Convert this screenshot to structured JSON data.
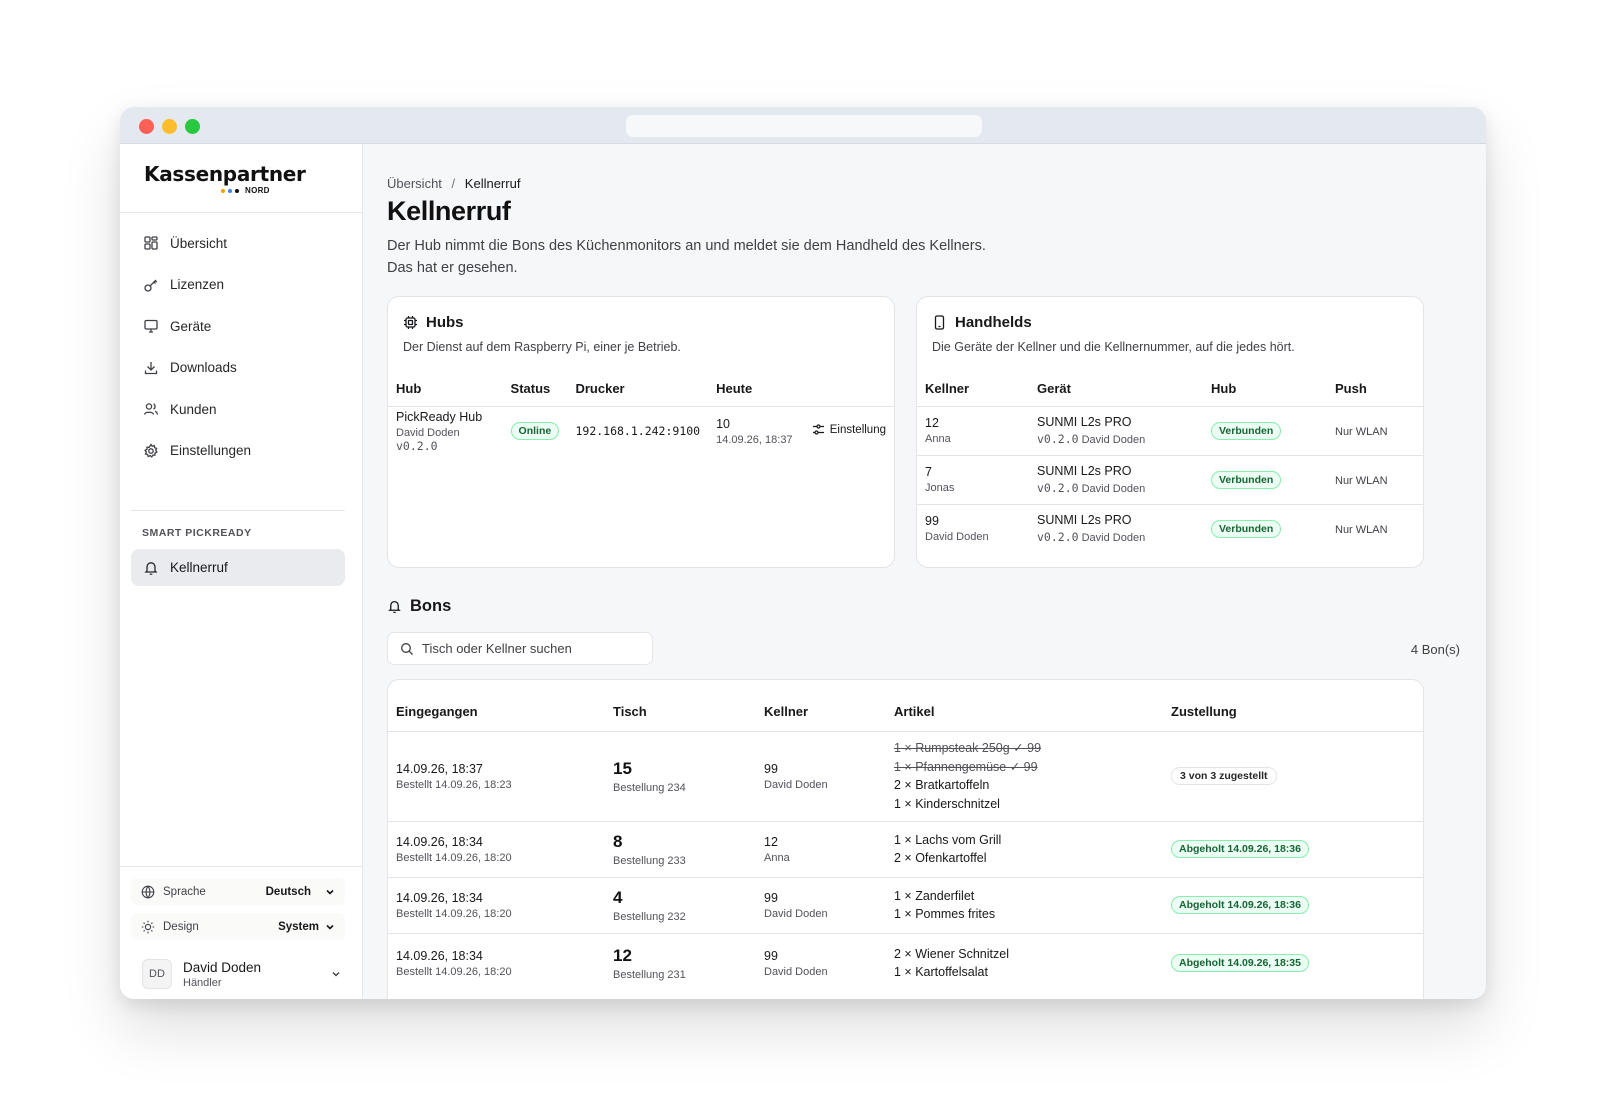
{
  "brand": {
    "name": "Kassenpartner",
    "sub": "NORD",
    "dot_colors": [
      "#f59e0b",
      "#3b82f6",
      "#111111"
    ]
  },
  "sidebar": {
    "items": [
      {
        "label": "Übersicht",
        "icon": "grid-icon"
      },
      {
        "label": "Lizenzen",
        "icon": "key-icon"
      },
      {
        "label": "Geräte",
        "icon": "monitor-icon"
      },
      {
        "label": "Downloads",
        "icon": "download-icon"
      },
      {
        "label": "Kunden",
        "icon": "users-icon"
      },
      {
        "label": "Einstellungen",
        "icon": "gear-icon"
      }
    ],
    "section_label": "SMART PICKREADY",
    "active_item": {
      "label": "Kellnerruf",
      "icon": "bell-icon"
    },
    "language_label": "Sprache",
    "language_value": "Deutsch",
    "design_label": "Design",
    "design_value": "System",
    "user": {
      "initials": "DD",
      "name": "David Doden",
      "role": "Händler"
    }
  },
  "breadcrumb": {
    "root": "Übersicht",
    "sep": "/",
    "current": "Kellnerruf"
  },
  "page": {
    "title": "Kellnerruf",
    "desc_line1": "Der Hub nimmt die Bons des Küchenmonitors an und meldet sie dem Handheld des Kellners.",
    "desc_line2": "Das hat er gesehen."
  },
  "hubs": {
    "title": "Hubs",
    "subtitle": "Der Dienst auf dem Raspberry Pi, einer je Betrieb.",
    "columns": [
      "Hub",
      "Status",
      "Drucker",
      "Heute"
    ],
    "rows": [
      {
        "name": "PickReady Hub",
        "owner": "David Doden",
        "version": "v0.2.0",
        "status": "Online",
        "printer": "192.168.1.242:9100",
        "today": "10",
        "today_time": "14.09.26, 18:37",
        "action": "Einstellung"
      }
    ]
  },
  "handhelds": {
    "title": "Handhelds",
    "subtitle": "Die Geräte der Kellner und die Kellnernummer, auf die jedes hört.",
    "columns": [
      "Kellner",
      "Gerät",
      "Hub",
      "Push"
    ],
    "rows": [
      {
        "number": "12",
        "name": "Anna",
        "device": "SUNMI L2s PRO",
        "version": "v0.2.0",
        "owner": "David Doden",
        "hub": "Verbunden",
        "push": "Nur WLAN"
      },
      {
        "number": "7",
        "name": "Jonas",
        "device": "SUNMI L2s PRO",
        "version": "v0.2.0",
        "owner": "David Doden",
        "hub": "Verbunden",
        "push": "Nur WLAN"
      },
      {
        "number": "99",
        "name": "David Doden",
        "device": "SUNMI L2s PRO",
        "version": "v0.2.0",
        "owner": "David Doden",
        "hub": "Verbunden",
        "push": "Nur WLAN"
      }
    ]
  },
  "bons": {
    "title": "Bons",
    "search_placeholder": "Tisch oder Kellner suchen",
    "count": "4 Bon(s)",
    "columns": [
      "Eingegangen",
      "Tisch",
      "Kellner",
      "Artikel",
      "Zustellung"
    ],
    "rows": [
      {
        "received": "14.09.26, 18:37",
        "ordered": "Bestellt 14.09.26, 18:23",
        "table": "15",
        "order": "Bestellung 234",
        "waiter": "99",
        "waiter_name": "David Doden",
        "items": [
          "1 × Rumpsteak 250g ✓ 99",
          "1 × Pfannengemüse ✓ 99",
          "2 × Bratkartoffeln",
          "1 × Kinderschnitzel"
        ],
        "delivery": "3 von 3 zugestellt"
      },
      {
        "received": "14.09.26, 18:34",
        "ordered": "Bestellt 14.09.26, 18:20",
        "table": "8",
        "order": "Bestellung 233",
        "waiter": "12",
        "waiter_name": "Anna",
        "items": [
          "1 × Lachs vom Grill",
          "2 × Ofenkartoffel"
        ],
        "delivery": "Abgeholt 14.09.26, 18:36"
      },
      {
        "received": "14.09.26, 18:34",
        "ordered": "Bestellt 14.09.26, 18:20",
        "table": "4",
        "order": "Bestellung 232",
        "waiter": "99",
        "waiter_name": "David Doden",
        "items": [
          "1 × Zanderfilet",
          "1 × Pommes frites"
        ],
        "delivery": "Abgeholt 14.09.26, 18:36"
      },
      {
        "received": "14.09.26, 18:34",
        "ordered": "Bestellt 14.09.26, 18:20",
        "table": "12",
        "order": "Bestellung 231",
        "waiter": "99",
        "waiter_name": "David Doden",
        "items": [
          "2 × Wiener Schnitzel",
          "1 × Kartoffelsalat"
        ],
        "delivery": "Abgeholt 14.09.26, 18:35"
      }
    ]
  }
}
